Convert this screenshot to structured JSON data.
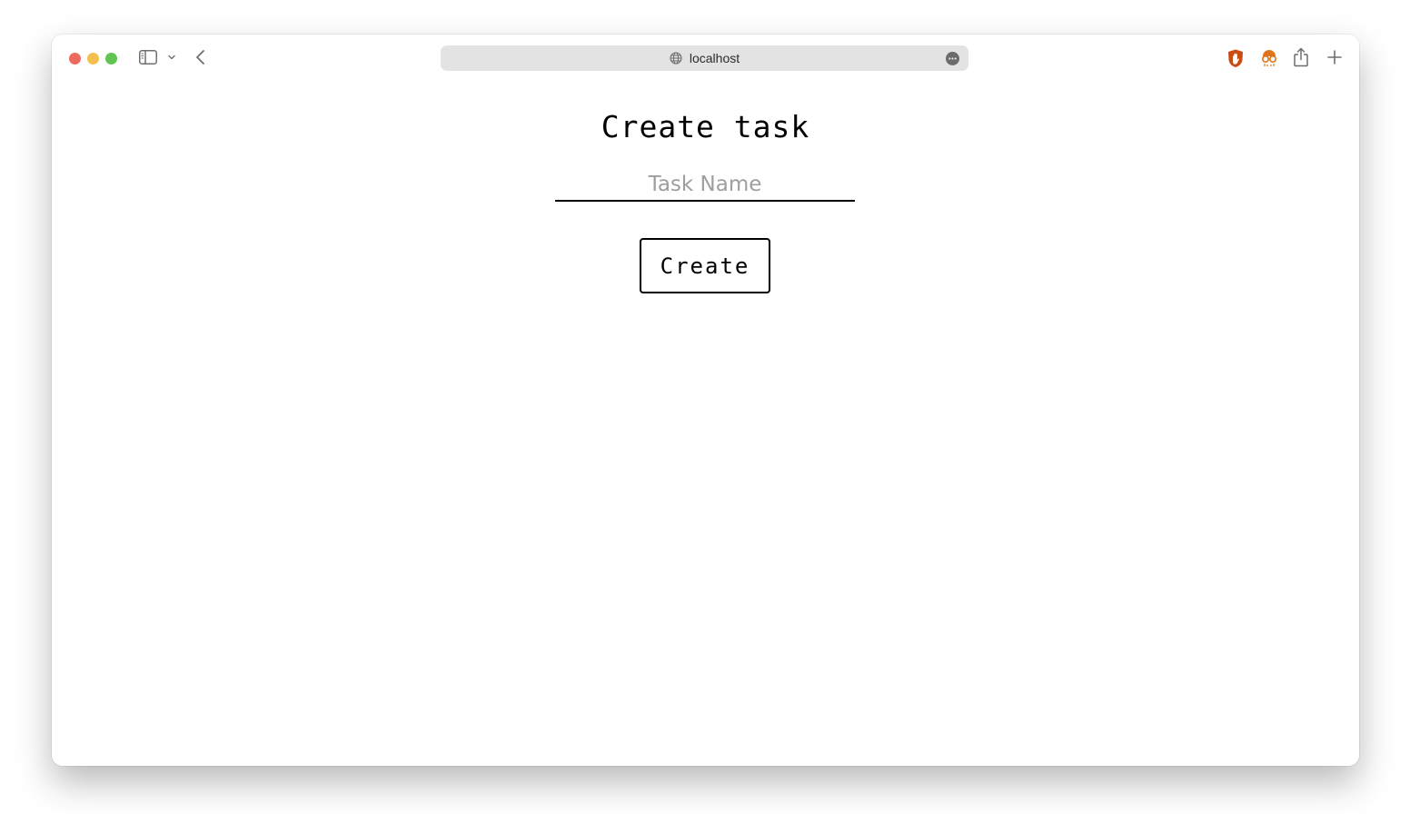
{
  "browser": {
    "url": "localhost",
    "traffic_lights": {
      "close_color": "#ed6a5e",
      "minimize_color": "#f5bf4f",
      "maximize_color": "#61c554"
    },
    "icons": {
      "sidebar": "sidebar-icon",
      "sidebar_menu": "chevron-down-icon",
      "back": "chevron-left-icon",
      "site": "globe-icon",
      "page_menu": "more-icon",
      "extension_1": "hand-icon",
      "extension_2": "glasses-icon",
      "share": "share-icon",
      "new_tab": "plus-icon"
    },
    "extension_colors": {
      "hand": "#c94d12",
      "glasses": "#e0741a"
    }
  },
  "page": {
    "title": "Create task",
    "task_input": {
      "placeholder": "Task Name",
      "value": ""
    },
    "create_button_label": "Create"
  }
}
